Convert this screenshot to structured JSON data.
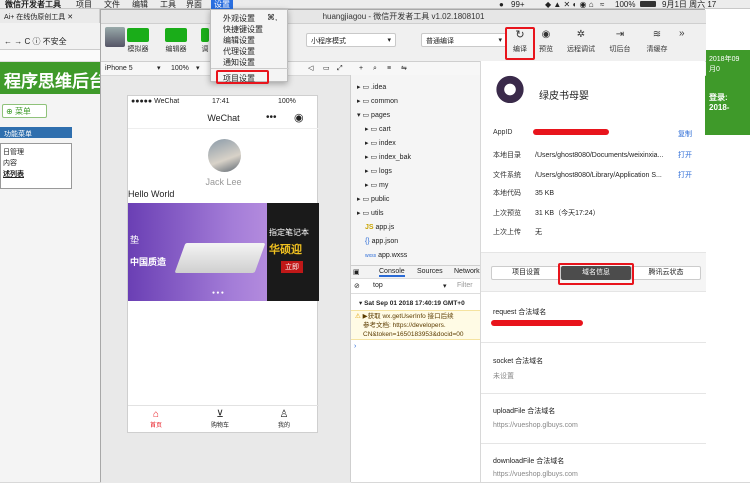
{
  "menubar": {
    "app_name": "微信开发者工具",
    "items": [
      "项目",
      "文件",
      "编辑",
      "工具",
      "界面",
      "设置"
    ],
    "right": {
      "percent": "99+",
      "battery": "100%",
      "datetime": "9月1日 周六 17"
    }
  },
  "browser": {
    "tab_title": "Ai+ 在线伪原创工具",
    "address": "不安全",
    "page_title": "程序思维后台",
    "menu_button": "菜单",
    "function_menu": "功能菜单",
    "left_items": [
      "日管理",
      "内容",
      "述列表"
    ],
    "right_text": [
      "2018年09月0",
      "登录: 2018-"
    ]
  },
  "devtools": {
    "title": "huangjiagou - 微信开发者工具 v1.02.1808101",
    "toolbar": {
      "simulator": "模拟器",
      "editor": "编辑器",
      "debugger": "调",
      "mode_select": "小程序模式",
      "compile_select": "普通编译",
      "compile": "编译",
      "preview": "预览",
      "remote_debug": "远程调试",
      "background": "切后台",
      "clear_cache": "清缓存"
    },
    "subbar": {
      "device": "iPhone 5",
      "zoom": "100%"
    }
  },
  "settings_menu": {
    "items": [
      {
        "label": "外观设置",
        "shortcut": "⌘,"
      },
      {
        "label": "快捷键设置",
        "shortcut": ""
      },
      {
        "label": "编辑设置",
        "shortcut": ""
      },
      {
        "label": "代理设置",
        "shortcut": ""
      },
      {
        "label": "通知设置",
        "shortcut": ""
      }
    ],
    "project_settings": "项目设置"
  },
  "phone": {
    "carrier": "●●●●● WeChat",
    "time": "17:41",
    "battery": "100%",
    "nav_title": "WeChat",
    "user_name": "Jack Lee",
    "hello": "Hello World",
    "banner_text1": "垫",
    "banner_text2": "中国质造",
    "banner2_line1": "指定笔记本",
    "banner2_line2": "华硕迎",
    "banner2_btn": "立即",
    "tabbar": [
      "首页",
      "购物车",
      "我的"
    ]
  },
  "file_tree": [
    {
      "name": ".idea",
      "type": "folder",
      "indent": 0,
      "open": false
    },
    {
      "name": "common",
      "type": "folder",
      "indent": 0,
      "open": false
    },
    {
      "name": "pages",
      "type": "folder",
      "indent": 0,
      "open": true
    },
    {
      "name": "cart",
      "type": "folder",
      "indent": 1,
      "open": false
    },
    {
      "name": "index",
      "type": "folder",
      "indent": 1,
      "open": false
    },
    {
      "name": "index_bak",
      "type": "folder",
      "indent": 1,
      "open": false
    },
    {
      "name": "logs",
      "type": "folder",
      "indent": 1,
      "open": false
    },
    {
      "name": "my",
      "type": "folder",
      "indent": 1,
      "open": false
    },
    {
      "name": "public",
      "type": "folder",
      "indent": 0,
      "open": false
    },
    {
      "name": "utils",
      "type": "folder",
      "indent": 0,
      "open": false
    },
    {
      "name": "app.js",
      "type": "js",
      "indent": 0
    },
    {
      "name": "app.json",
      "type": "json",
      "indent": 0
    },
    {
      "name": "app.wxss",
      "type": "wxss",
      "indent": 0
    }
  ],
  "console": {
    "tabs": [
      "Console",
      "Sources",
      "Network"
    ],
    "context": "top",
    "filter_placeholder": "Filter",
    "log_time": "Sat Sep 01 2018 17:40:19 GMT+0",
    "warn_line1": "▶获取 wx.getUserInfo 接口后续",
    "warn_line2": "参考文档: https://developers.",
    "warn_line3": "CN&token=1650183953&docid=00"
  },
  "project": {
    "name": "绿皮书母婴",
    "rows": [
      {
        "label": "AppID",
        "value": "",
        "action": "复制"
      },
      {
        "label": "本地目录",
        "value": "/Users/ghost8080/Documents/weixinxia...",
        "action": "打开"
      },
      {
        "label": "文件系统",
        "value": "/Users/ghost8080/Library/Application S...",
        "action": "打开"
      },
      {
        "label": "本地代码",
        "value": "35 KB",
        "action": ""
      },
      {
        "label": "上次预览",
        "value": "31 KB（今天17:24）",
        "action": ""
      },
      {
        "label": "上次上传",
        "value": "无",
        "action": ""
      }
    ],
    "tabs": [
      "项目设置",
      "域名信息",
      "腾讯云状态"
    ],
    "sections": [
      {
        "title": "request 合法域名",
        "value": ""
      },
      {
        "title": "socket 合法域名",
        "value": "未设置"
      },
      {
        "title": "uploadFile 合法域名",
        "value": "https://vueshop.glbuys.com"
      },
      {
        "title": "downloadFile 合法域名",
        "value": "https://vueshop.glbuys.com"
      }
    ]
  },
  "colors": {
    "wechat_green": "#1aad19",
    "highlight_red": "#e8141c",
    "link_blue": "#2b6bd6",
    "tab_red": "#e8141c"
  }
}
